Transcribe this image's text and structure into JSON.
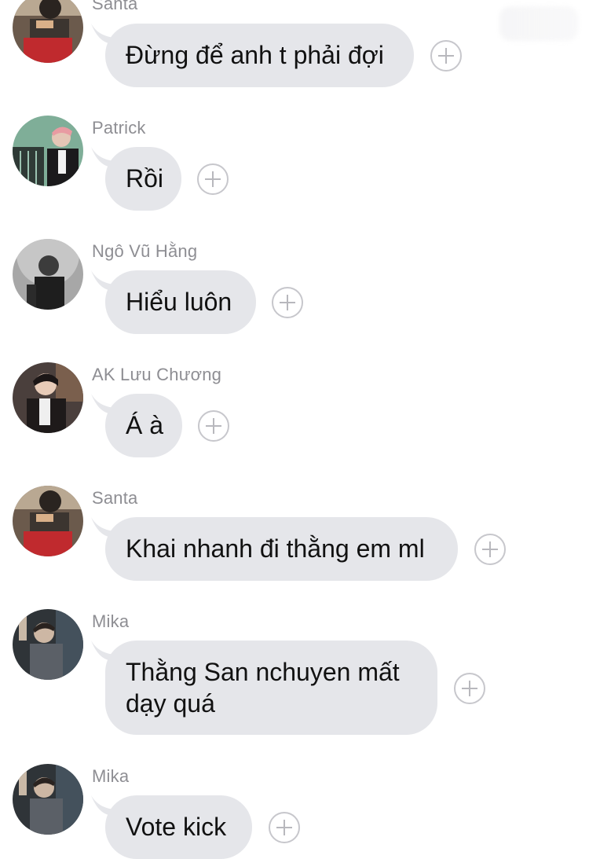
{
  "messages": [
    {
      "sender": "Santa",
      "text": "Đừng để anh t phải đợi",
      "avatar": "santa-avatar"
    },
    {
      "sender": "Patrick",
      "text": "Rồi",
      "avatar": "patrick-avatar"
    },
    {
      "sender": "Ngô Vũ Hằng",
      "text": "Hiểu luôn",
      "avatar": "ngo-vu-hang-avatar"
    },
    {
      "sender": "AK Lưu Chương",
      "text": "Á à",
      "avatar": "ak-luu-chuong-avatar"
    },
    {
      "sender": "Santa",
      "text": "Khai nhanh đi thằng em ml",
      "avatar": "santa-avatar"
    },
    {
      "sender": "Mika",
      "text_lines": [
        "Thằng San nchuyen mất",
        "dạy quá"
      ],
      "avatar": "mika-avatar"
    },
    {
      "sender": "Mika",
      "text": "Vote kick",
      "avatar": "mika-avatar"
    }
  ],
  "icons": {
    "react": "add-reaction-icon",
    "tail": "bubble-tail-icon"
  },
  "colors": {
    "bubble": "#e5e6ea",
    "sender": "#8e8e93",
    "text": "#111111",
    "react_border": "#c7c7cc"
  }
}
